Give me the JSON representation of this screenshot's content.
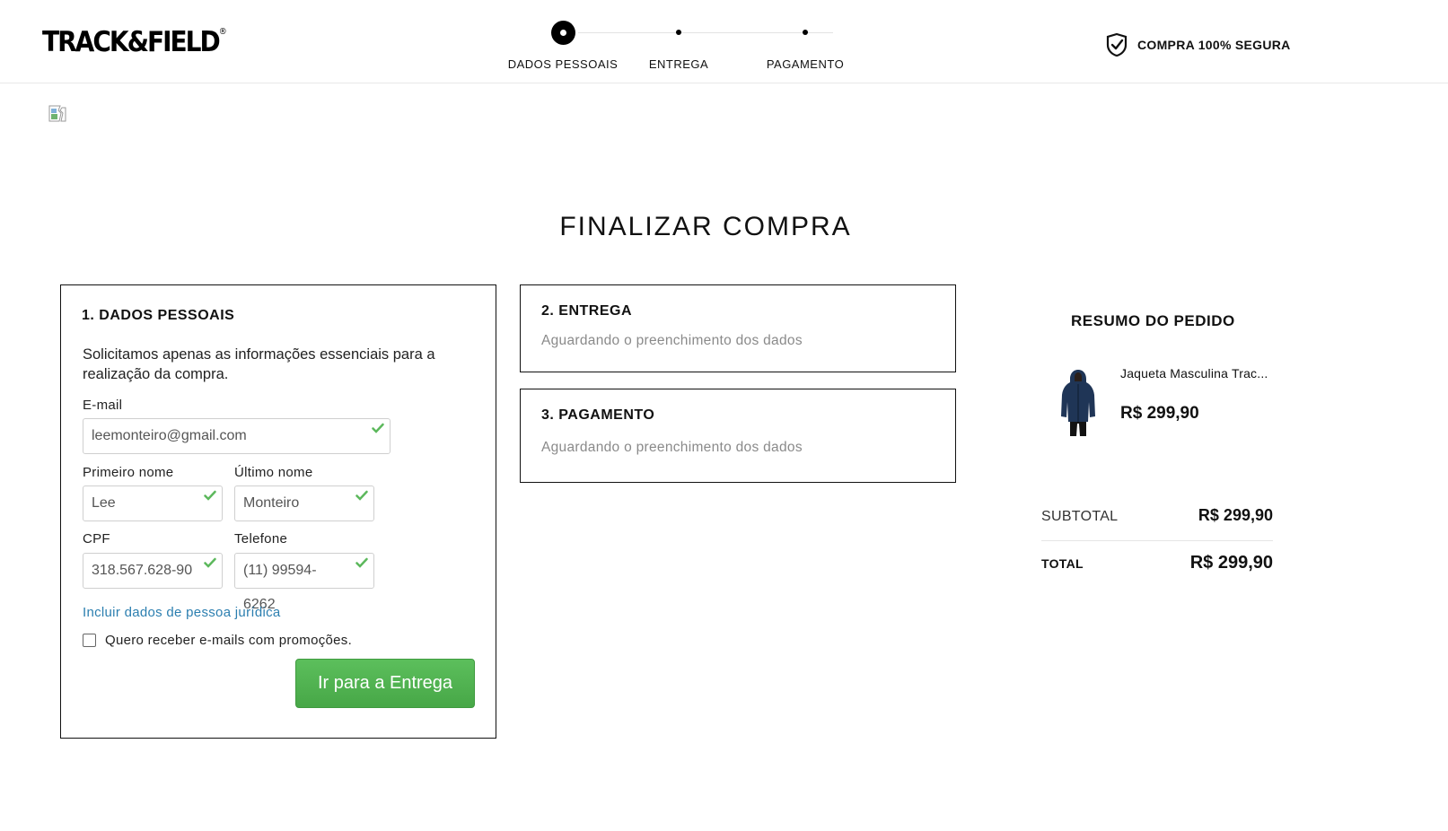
{
  "header": {
    "logo_text": "TRACK&FIELD",
    "logo_mark": "®",
    "steps": [
      {
        "label": "DADOS PESSOAIS",
        "active": true
      },
      {
        "label": "ENTREGA",
        "active": false
      },
      {
        "label": "PAGAMENTO",
        "active": false
      }
    ],
    "secure_icon": "shield-check-icon",
    "secure_label": "COMPRA 100% SEGURA"
  },
  "page_title": "FINALIZAR COMPRA",
  "personal": {
    "heading": "1. DADOS PESSOAIS",
    "intro": "Solicitamos apenas as informações essenciais para a realização da compra.",
    "email_label": "E-mail",
    "email_value": "leemonteiro@gmail.com",
    "first_name_label": "Primeiro nome",
    "first_name_value": "Lee",
    "last_name_label": "Último nome",
    "last_name_value": "Monteiro",
    "cpf_label": "CPF",
    "cpf_value": "318.567.628-90",
    "phone_label": "Telefone",
    "phone_value": "(11) 99594-6262",
    "pj_link": "Incluir dados de pessoa jurídica",
    "promo_label": "Quero receber e-mails com promoções.",
    "promo_checked": false,
    "next_button": "Ir para a Entrega"
  },
  "delivery": {
    "heading": "2. ENTREGA",
    "status": "Aguardando o preenchimento dos dados"
  },
  "payment": {
    "heading": "3. PAGAMENTO",
    "status": "Aguardando o preenchimento dos dados"
  },
  "summary": {
    "heading": "RESUMO DO PEDIDO",
    "product_name": "Jaqueta Masculina Trac...",
    "product_price": "R$ 299,90",
    "subtotal_label": "SUBTOTAL",
    "subtotal_value": "R$ 299,90",
    "total_label": "TOTAL",
    "total_value": "R$ 299,90"
  },
  "colors": {
    "accent_green": "#4caf50",
    "check_green": "#5cb85c",
    "link_blue": "#2c7fb0",
    "muted_text": "#8a8a8a"
  }
}
